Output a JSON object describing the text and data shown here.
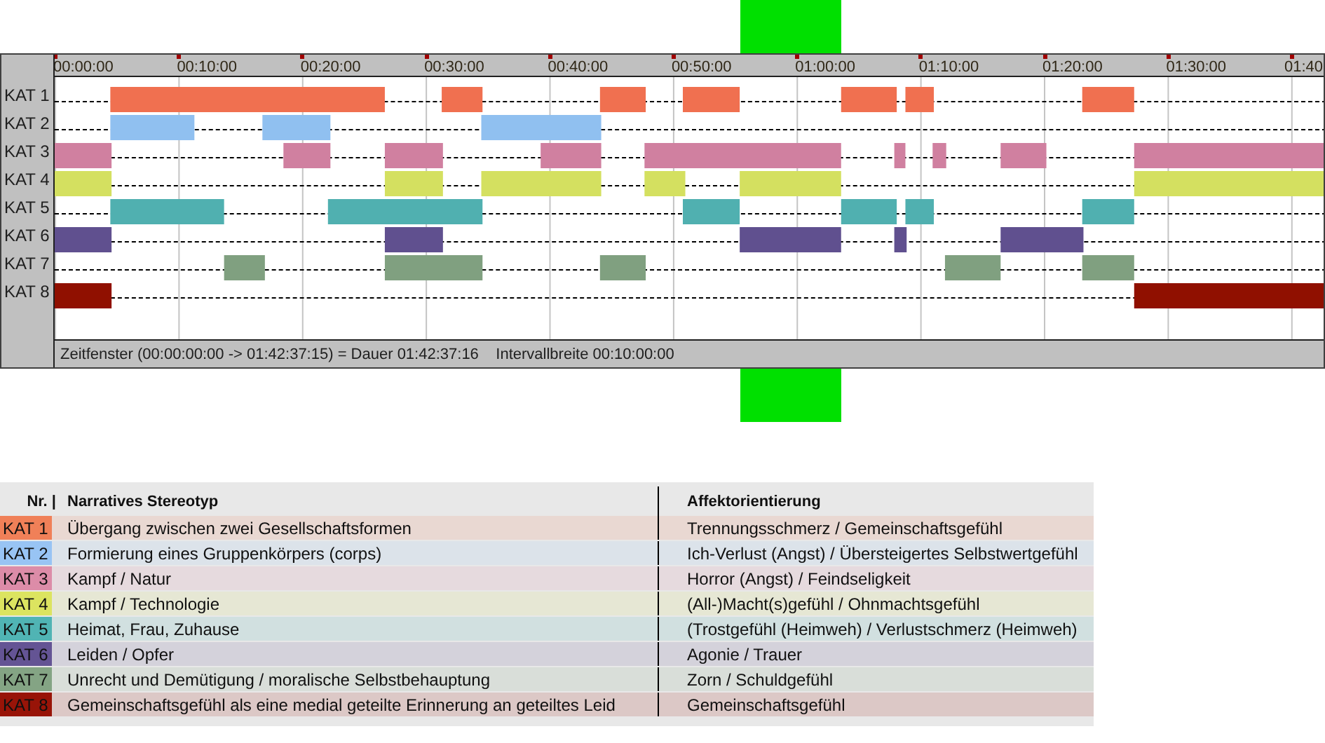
{
  "timeline": {
    "ticks": [
      "00:00:00",
      "00:10:00",
      "00:20:00",
      "00:30:00",
      "00:40:00",
      "00:50:00",
      "01:00:00",
      "01:10:00",
      "01:20:00",
      "01:30:00",
      "01:40"
    ],
    "rows": [
      {
        "label": "KAT 1",
        "color": "#f07050"
      },
      {
        "label": "KAT 2",
        "color": "#90c0f0"
      },
      {
        "label": "KAT 3",
        "color": "#d080a0"
      },
      {
        "label": "KAT 4",
        "color": "#d4e060"
      },
      {
        "label": "KAT 5",
        "color": "#50b0b0"
      },
      {
        "label": "KAT 6",
        "color": "#60508f"
      },
      {
        "label": "KAT 7",
        "color": "#80a080"
      },
      {
        "label": "KAT 8",
        "color": "#901000"
      }
    ],
    "status": "Zeitfenster (00:00:00:00 -> 01:42:37:15) = Dauer 01:42:37:16    Intervallbreite 00:10:00:00"
  },
  "legend": {
    "columns": [
      "Nr. |",
      "Narratives Stereotyp",
      "Affektorientierung"
    ],
    "rows": [
      {
        "nr": "KAT 1",
        "color": "#f08058",
        "stereotype": "Übergang zwischen zwei Gesellschaftsformen",
        "affect": "Trennungsschmerz / Gemeinschaftsgefühl"
      },
      {
        "nr": "KAT 2",
        "color": "#98c4f4",
        "stereotype": "Formierung eines Gruppenkörpers (corps)",
        "affect": "Ich-Verlust (Angst) / Übersteigertes Selbstwertgefühl"
      },
      {
        "nr": "KAT 3",
        "color": "#dc8ca8",
        "stereotype": "Kampf / Natur",
        "affect": "Horror (Angst) / Feindseligkeit"
      },
      {
        "nr": "KAT 4",
        "color": "#dce460",
        "stereotype": "Kampf / Technologie",
        "affect": "(All-)Macht(s)gefühl / Ohnmachtsgefühl"
      },
      {
        "nr": "KAT 5",
        "color": "#50b4b4",
        "stereotype": "Heimat, Frau, Zuhause",
        "affect": "(Trostgefühl (Heimweh) / Verlustschmerz (Heimweh)"
      },
      {
        "nr": "KAT 6",
        "color": "#645494",
        "stereotype": "Leiden / Opfer",
        "affect": "Agonie / Trauer"
      },
      {
        "nr": "KAT 7",
        "color": "#84a484",
        "stereotype": "Unrecht und Demütigung / moralische Selbstbehauptung",
        "affect": "Zorn / Schuldgefühl"
      },
      {
        "nr": "KAT 8",
        "color": "#981408",
        "stereotype": "Gemeinschaftsgefühl als eine medial geteilte Erinnerung an geteiltes Leid",
        "affect": "Gemeinschaftsgefühl"
      }
    ]
  }
}
